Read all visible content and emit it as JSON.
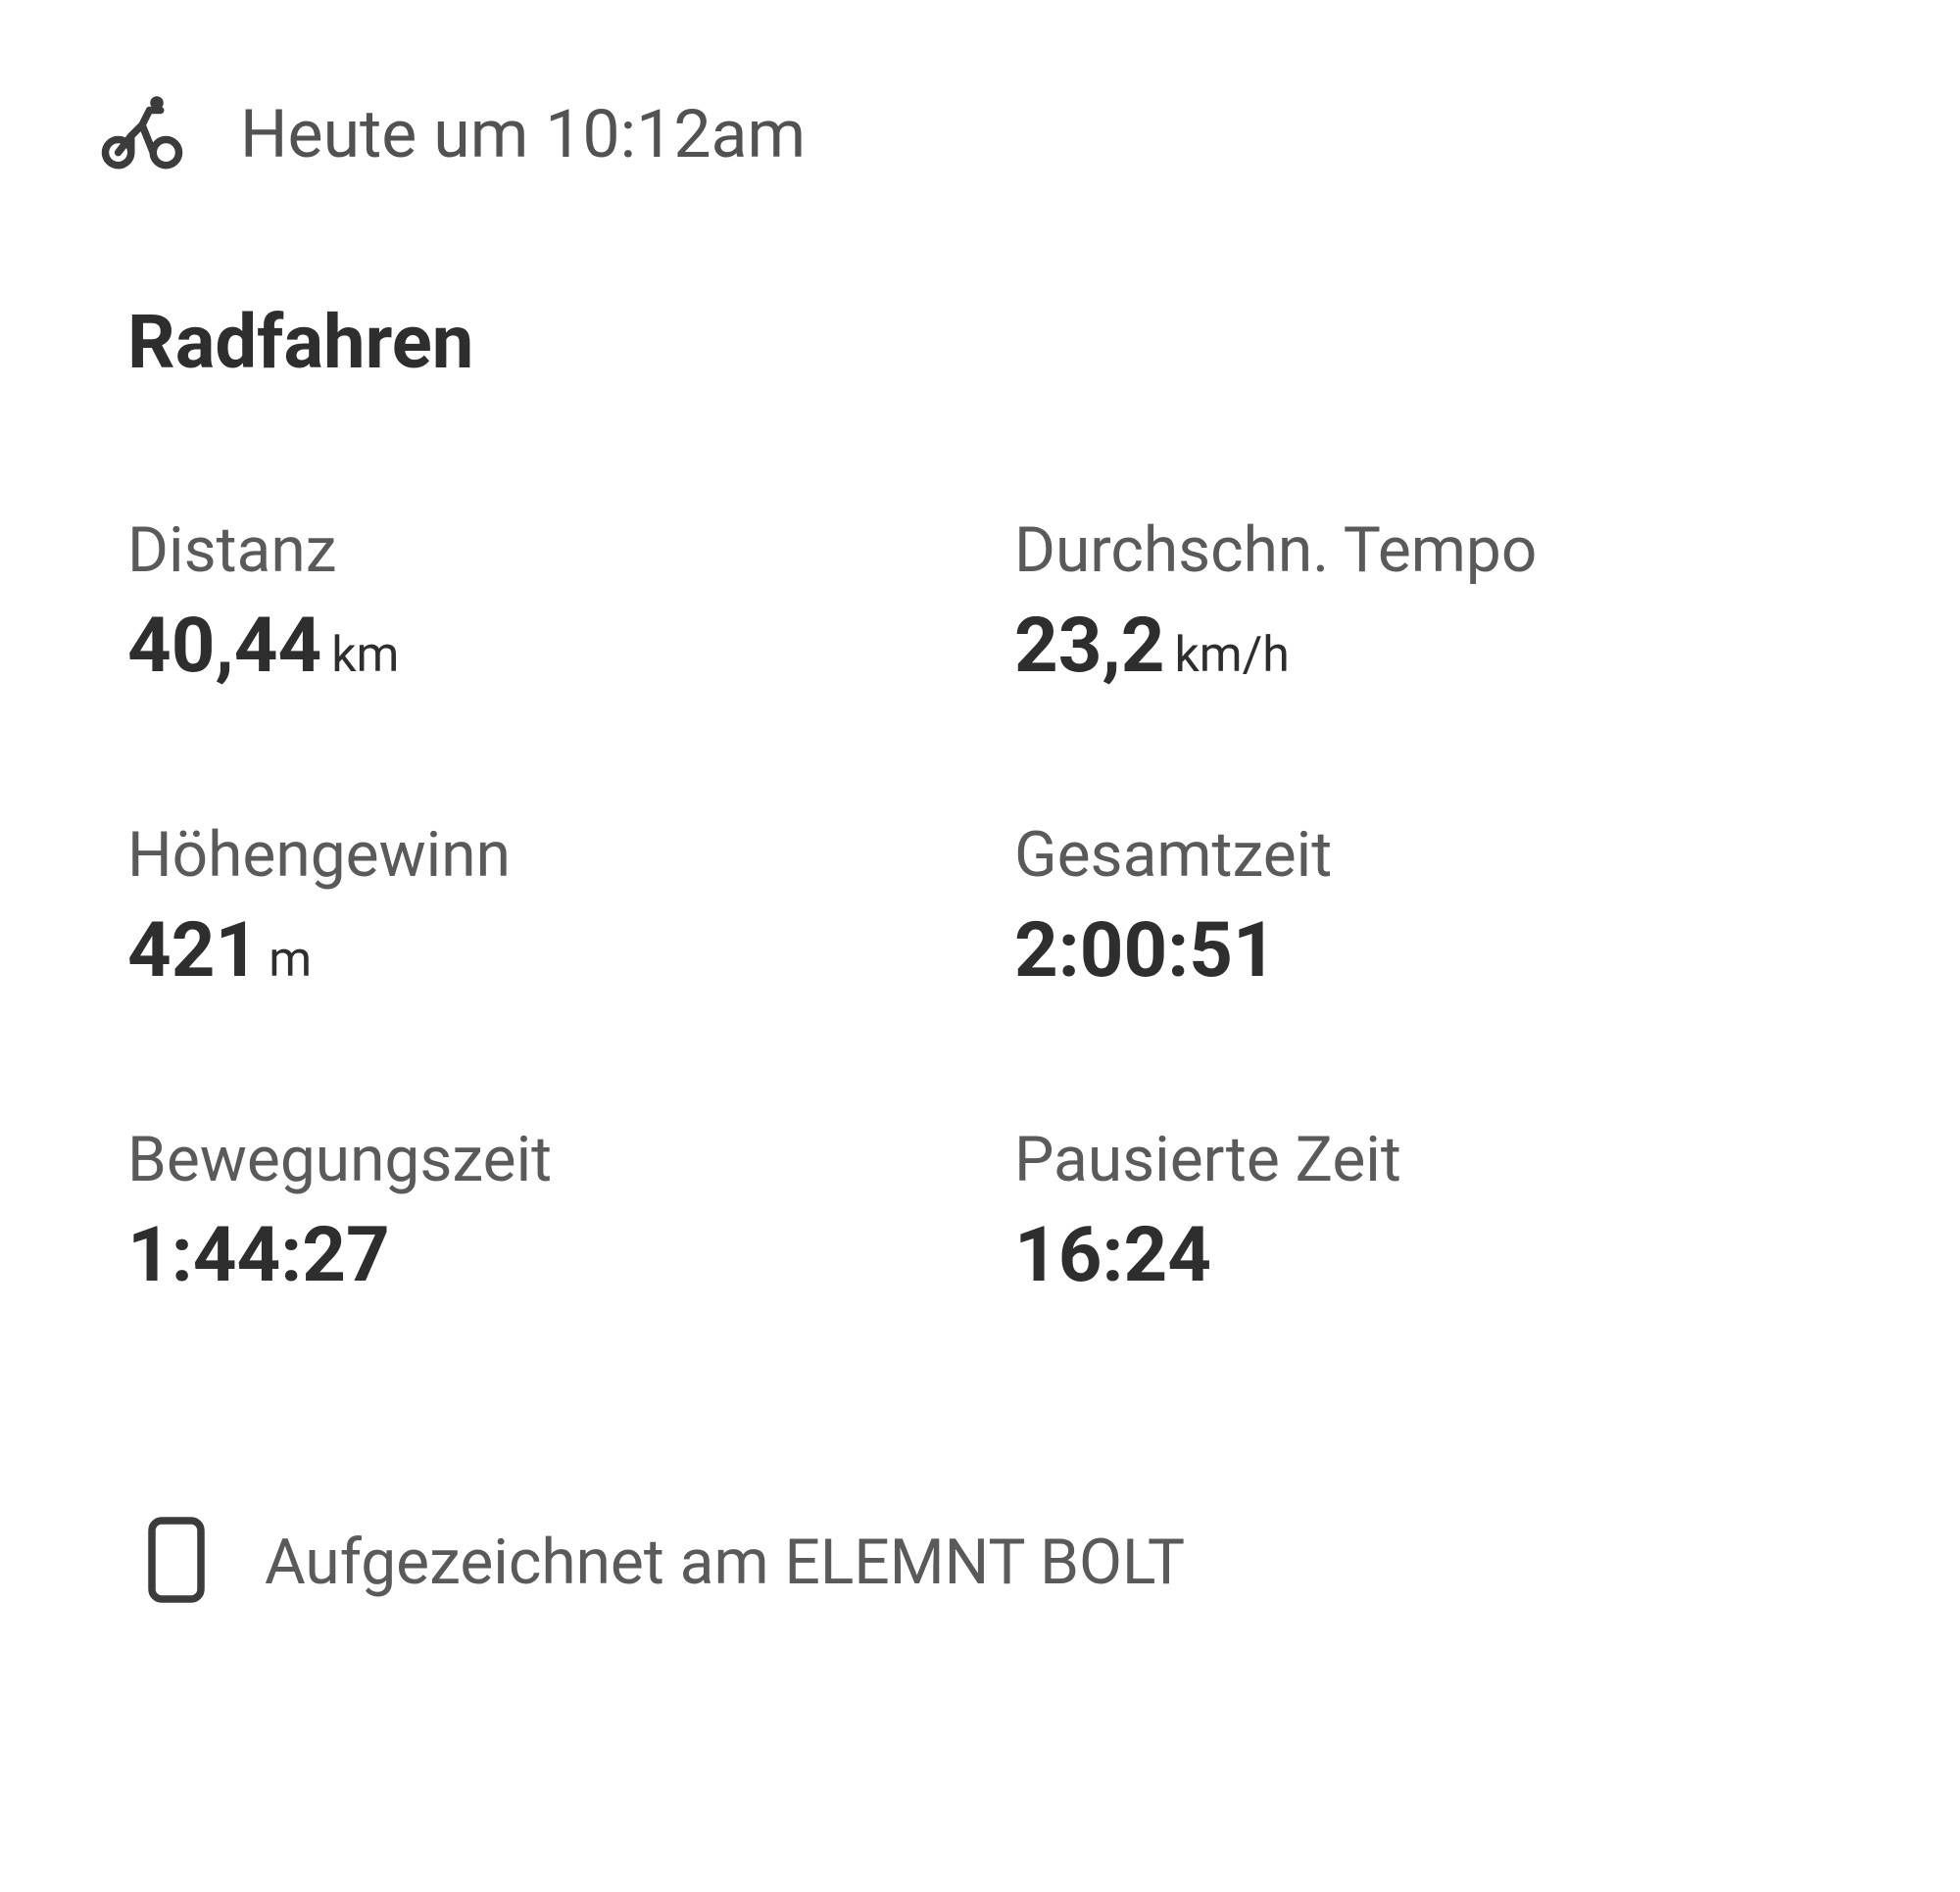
{
  "header": {
    "timestamp": "Heute um 10:12am"
  },
  "activity": {
    "title": "Radfahren"
  },
  "stats": {
    "distance": {
      "label": "Distanz",
      "value": "40,44",
      "unit": "km"
    },
    "avgSpeed": {
      "label": "Durchschn. Tempo",
      "value": "23,2",
      "unit": "km/h"
    },
    "elevation": {
      "label": "Höhengewinn",
      "value": "421",
      "unit": "m"
    },
    "totalTime": {
      "label": "Gesamtzeit",
      "value": "2:00:51",
      "unit": ""
    },
    "movingTime": {
      "label": "Bewegungszeit",
      "value": "1:44:27",
      "unit": ""
    },
    "pausedTime": {
      "label": "Pausierte Zeit",
      "value": "16:24",
      "unit": ""
    }
  },
  "footer": {
    "recordedOn": "Aufgezeichnet am ELEMNT BOLT"
  }
}
